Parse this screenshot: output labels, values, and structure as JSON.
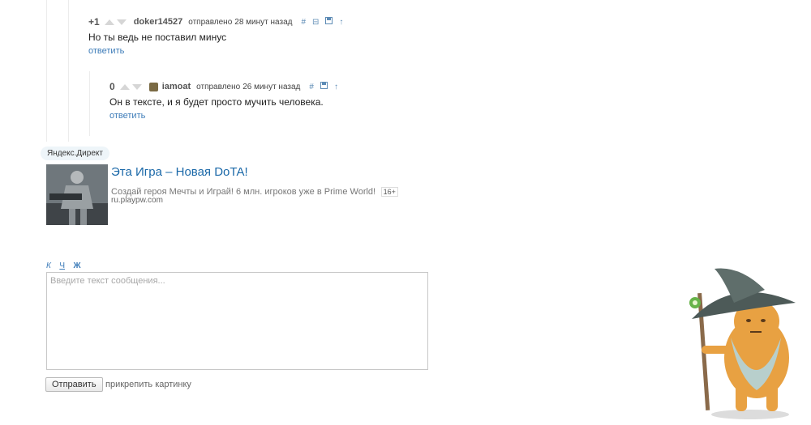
{
  "comments": [
    {
      "rating": "+1",
      "author": "doker14527",
      "sent_label": "отправлено",
      "time": "28 минут назад",
      "text": "Но ты ведь не поставил минус",
      "reply_label": "ответить"
    },
    {
      "rating": "0",
      "author": "iamoat",
      "sent_label": "отправлено",
      "time": "26 минут назад",
      "text": "Он в тексте, и я будет просто мучить человека.",
      "reply_label": "ответить"
    }
  ],
  "ad": {
    "badge": "Яндекс.Директ",
    "title": "Эта Игра – Новая DoTA!",
    "text": "Создай героя Мечты и Играй! 6 млн. игроков уже в Prime World!",
    "age": "16+",
    "domain": "ru.playpw.com"
  },
  "editor": {
    "format_italic": "К",
    "format_underline": "Ч",
    "format_bold": "Ж",
    "placeholder": "Введите текст сообщения...",
    "submit_label": "Отправить",
    "attach_label": "прикрепить картинку"
  },
  "icons": {
    "hash": "#",
    "collapse": "⊟",
    "save": "💾",
    "up": "↑"
  },
  "colors": {
    "link": "#3c7bb8",
    "ad_title": "#1a68a8",
    "mascot_hat": "#4d5a58",
    "mascot_face": "#e8a142"
  }
}
